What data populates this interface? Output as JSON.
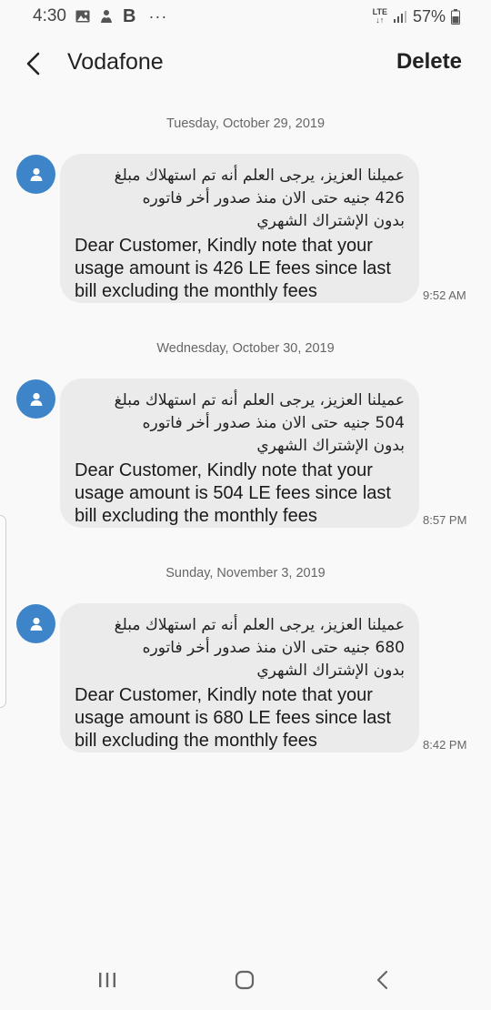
{
  "status_bar": {
    "time": "4:30",
    "b_label": "B",
    "more": "···",
    "network_type": "LTE",
    "battery": "57%"
  },
  "header": {
    "title": "Vodafone",
    "delete_label": "Delete"
  },
  "messages": [
    {
      "date": "Tuesday, October 29, 2019",
      "arabic_line1": "عميلنا العزيز، يرجى العلم أنه تم استهلاك مبلغ",
      "arabic_line2": "426 جنيه حتى الان منذ صدور أخر فاتوره",
      "arabic_line3": "بدون الإشتراك الشهري",
      "english": "Dear Customer, Kindly note that your usage amount is 426 LE fees since last bill excluding the monthly fees",
      "time": "9:52 AM"
    },
    {
      "date": "Wednesday, October 30, 2019",
      "arabic_line1": "عميلنا العزيز، يرجى العلم أنه تم استهلاك مبلغ",
      "arabic_line2": "504 جنيه حتى الان منذ صدور أخر فاتوره",
      "arabic_line3": "بدون الإشتراك الشهري",
      "english": "Dear Customer, Kindly note that your usage amount is 504 LE fees since last bill excluding the monthly fees",
      "time": "8:57 PM"
    },
    {
      "date": "Sunday, November 3, 2019",
      "arabic_line1": "عميلنا العزيز، يرجى العلم أنه تم استهلاك مبلغ",
      "arabic_line2": "680 جنيه حتى الان منذ صدور أخر فاتوره",
      "arabic_line3": "بدون الإشتراك الشهري",
      "english": "Dear Customer, Kindly note that your usage amount is 680 LE fees since last bill excluding the monthly fees",
      "time": "8:42 PM"
    }
  ],
  "icons": {
    "status": [
      "image-icon",
      "app-notification-icon",
      "signal-icon",
      "battery-icon"
    ],
    "header": [
      "back-arrow-icon"
    ],
    "avatar": [
      "person-icon"
    ],
    "nav": [
      "recent-apps-icon",
      "home-icon",
      "back-icon"
    ]
  },
  "colors": {
    "background": "#f9f9f9",
    "bubble": "#ebebeb",
    "avatar": "#3e84c8"
  }
}
